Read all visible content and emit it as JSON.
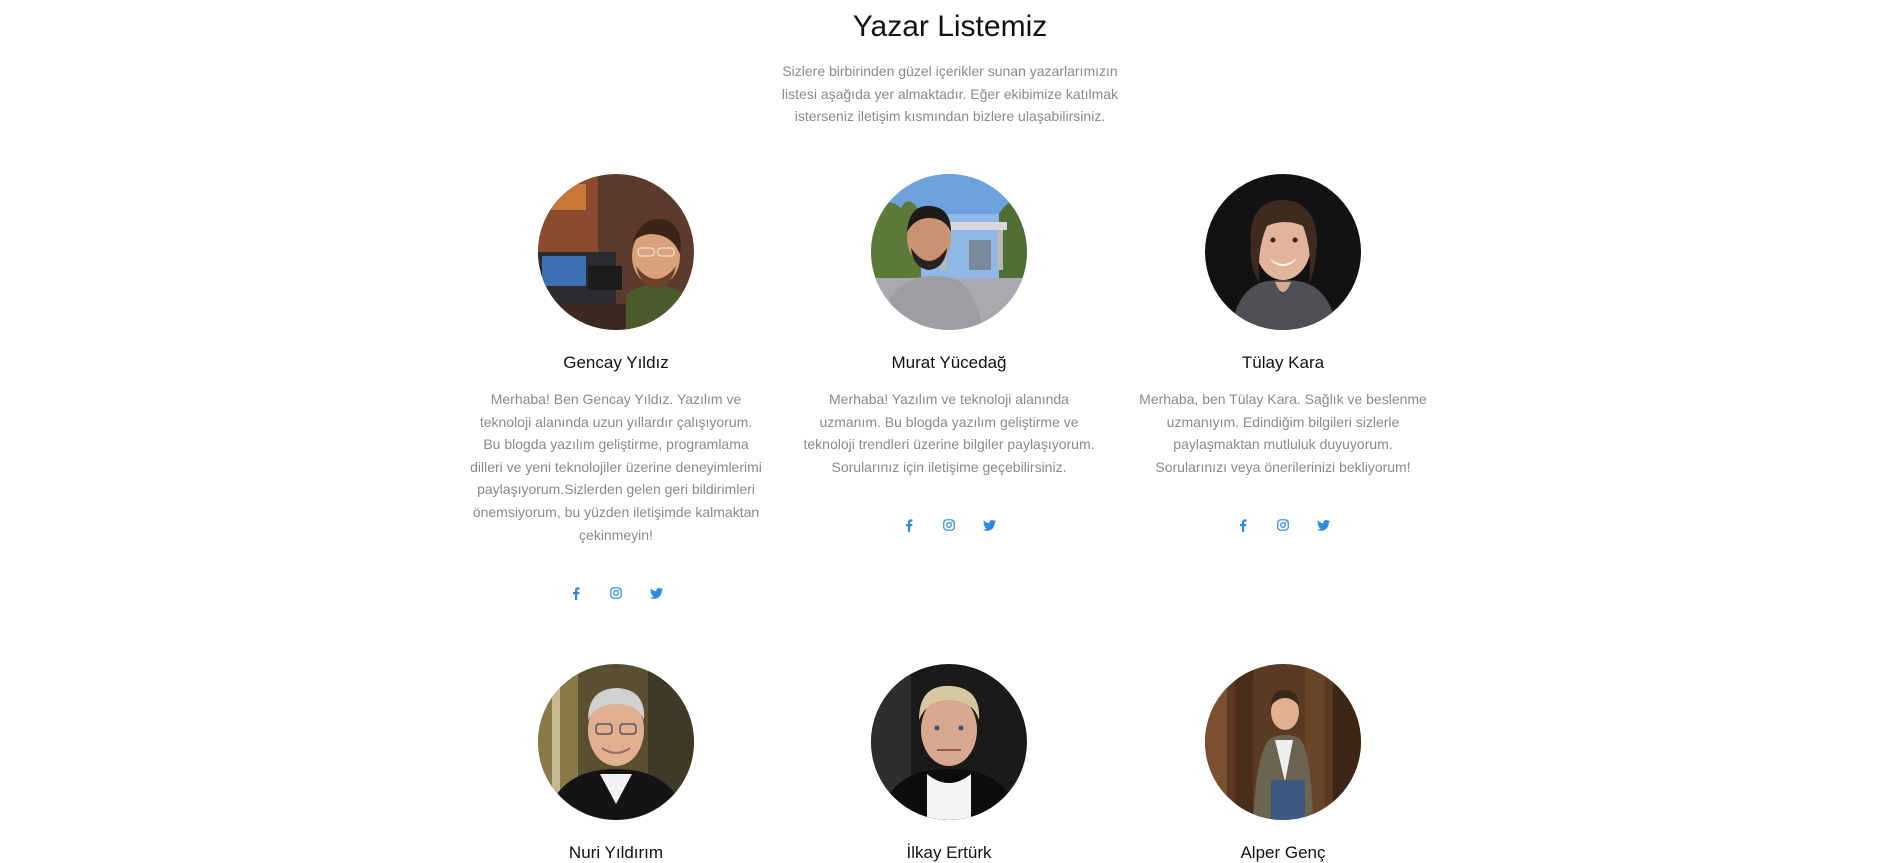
{
  "section": {
    "title": "Yazar Listemiz",
    "intro": "Sizlere birbirinden güzel içerikler sunan yazarlarımızın listesi aşağıda yer almaktadır. Eğer ekibimize katılmak isterseniz iletişim kısmından bizlere ulaşabilirsiniz."
  },
  "colors": {
    "accent": "#2f89e0",
    "text_muted": "#8a8a8a",
    "heading": "#111111"
  },
  "authors": [
    {
      "name": "Gencay Yıldız",
      "bio": "Merhaba! Ben Gencay Yıldız. Yazılım ve teknoloji alanında uzun yıllardır çalışıyorum. Bu blogda yazılım geliştirme, programlama dilleri ve yeni teknolojiler üzerine deneyimlerimi paylaşıyorum.Sizlerden gelen geri bildirimleri önemsiyorum, bu yüzden iletişimde kalmaktan çekinmeyin!",
      "social": [
        "facebook-icon",
        "instagram-icon",
        "twitter-icon"
      ]
    },
    {
      "name": "Murat Yücedağ",
      "bio": "Merhaba! Yazılım ve teknoloji alanında uzmanım. Bu blogda yazılım geliştirme ve teknoloji trendleri üzerine bilgiler paylaşıyorum. Sorularınız için iletişime geçebilirsiniz.",
      "social": [
        "facebook-icon",
        "instagram-icon",
        "twitter-icon"
      ]
    },
    {
      "name": "Tülay Kara",
      "bio": "Merhaba, ben Tülay Kara. Sağlık ve beslenme uzmanıyım. Edindiğim bilgileri sizlerle paylaşmaktan mutluluk duyuyorum. Sorularınızı veya önerilerinizi bekliyorum!",
      "social": [
        "facebook-icon",
        "instagram-icon",
        "twitter-icon"
      ]
    },
    {
      "name": "Nuri Yıldırım"
    },
    {
      "name": "İlkay Ertürk"
    },
    {
      "name": "Alper Genç"
    }
  ]
}
